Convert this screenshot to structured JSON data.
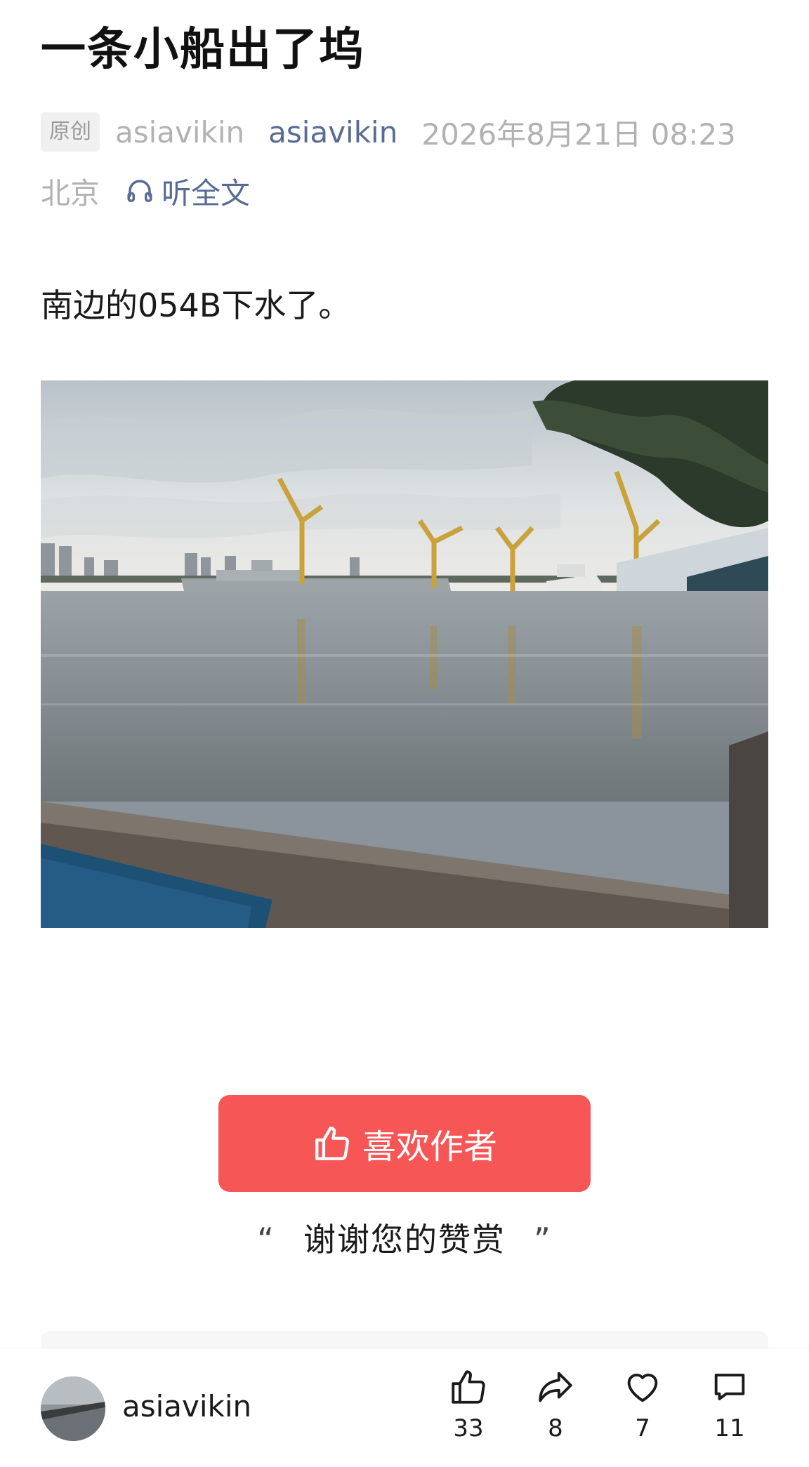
{
  "article": {
    "title": "一条小船出了坞",
    "badge": "原创",
    "author_plain": "asiavikin",
    "author_link": "asiavikin",
    "datetime": "2026年8月21日 08:23",
    "location": "北京",
    "listen_label": "听全文",
    "body_text": "南边的054B下水了。"
  },
  "reward": {
    "button_label": "喜欢作者",
    "thanks_open_quote": "“",
    "thanks_text": "谢谢您的赞赏",
    "thanks_close_quote": "”"
  },
  "bottom_bar": {
    "author": "asiavikin",
    "like_count": "33",
    "share_count": "8",
    "favorite_count": "7",
    "comment_count": "11"
  },
  "colors": {
    "link": "#576b95",
    "reward_button": "#f65655",
    "meta_gray": "#b2b2b2"
  }
}
